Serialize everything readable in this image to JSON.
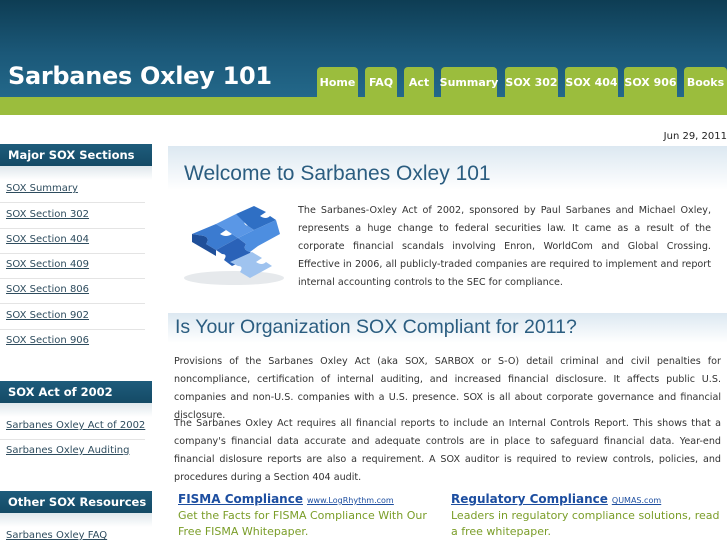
{
  "site": {
    "title": "Sarbanes Oxley 101"
  },
  "nav": {
    "items": [
      "Home",
      "FAQ",
      "Act",
      "Summary",
      "SOX 302",
      "SOX 404",
      "SOX 906",
      "Books"
    ]
  },
  "date": "Jun 29, 2011",
  "sidebar": {
    "sections": [
      {
        "heading": "Major SOX Sections",
        "links": [
          "SOX Summary",
          "SOX Section 302",
          "SOX Section 404",
          "SOX Section 409",
          "SOX Section 806",
          "SOX Section 902",
          "SOX Section 906"
        ]
      },
      {
        "heading": "SOX Act of 2002",
        "links": [
          "Sarbanes Oxley Act of 2002",
          "Sarbanes Oxley Auditing"
        ]
      },
      {
        "heading": "Other SOX Resources",
        "links": [
          "Sarbanes Oxley FAQ"
        ]
      }
    ]
  },
  "main": {
    "welcome_title": "Welcome to Sarbanes Oxley 101",
    "intro": "The Sarbanes-Oxley Act of 2002, sponsored by Paul Sarbanes and Michael Oxley, represents a huge change to federal securities law. It came as a result of the corporate financial scandals involving Enron, WorldCom and Global Crossing. Effective in 2006, all publicly-traded companies are required to implement and report internal accounting controls to the SEC for compliance.",
    "compliance_title": "Is Your Organization SOX Compliant for 2011?",
    "paragraph1": "Provisions of the Sarbanes Oxley Act (aka SOX, SARBOX or S-O) detail criminal and civil penalties for noncompliance, certification of internal auditing, and increased financial disclosure. It affects public U.S. companies and non-U.S. companies with a U.S. presence. SOX is all about corporate governance and financial disclosure.",
    "paragraph2": "The Sarbanes Oxley Act requires all financial reports to include an Internal Controls Report. This shows that a company's financial data accurate and adequate controls are in place to safeguard financial data. Year-end financial dislosure reports are also a requirement. A SOX auditor is required to review controls, policies, and procedures during a Section 404 audit."
  },
  "ads": [
    {
      "title": "FISMA Compliance",
      "url": "www.LogRhythm.com",
      "text": "Get the Facts for FISMA Compliance With Our Free FISMA Whitepaper."
    },
    {
      "title": "Regulatory Compliance",
      "url": "QUMAS.com",
      "text": "Leaders in regulatory compliance solutions, read a free whitepaper."
    }
  ],
  "colors": {
    "header": "#1b5878",
    "accent_green": "#9bbd3d",
    "heading_blue": "#2b5d80",
    "ad_green": "#7a9d28"
  }
}
